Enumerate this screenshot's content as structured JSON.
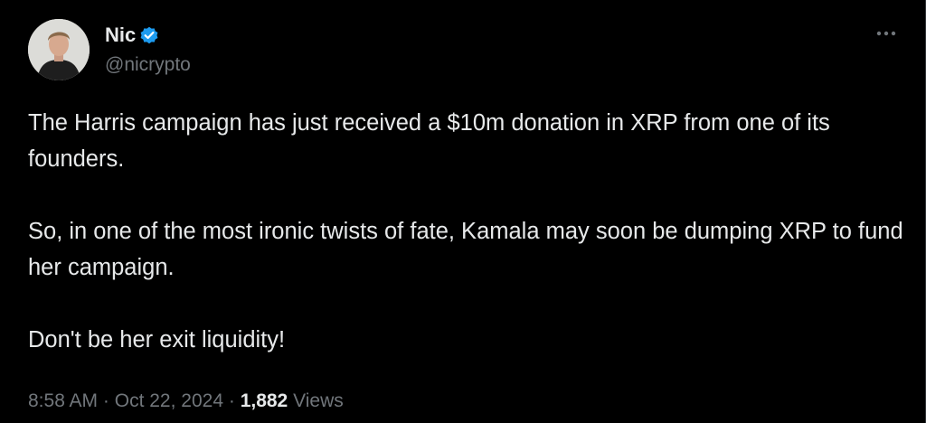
{
  "author": {
    "display_name": "Nic",
    "handle": "@nicrypto",
    "verified": true,
    "avatar_icon": "profile-photo"
  },
  "tweet": {
    "paragraphs": [
      "The Harris campaign has just received a $10m donation in XRP from one of its founders.",
      "So, in one of the most ironic twists of fate, Kamala may soon be dumping XRP to fund her campaign.",
      "Don't be her exit liquidity!"
    ]
  },
  "meta": {
    "time": "8:58 AM",
    "separator": "·",
    "date": "Oct 22, 2024",
    "views_count": "1,882",
    "views_label": "Views"
  },
  "icons": {
    "more": "more-dots-icon",
    "verified": "verified-badge-icon"
  },
  "colors": {
    "background": "#000000",
    "text": "#e7e9ea",
    "secondary_text": "#71767b",
    "verified_blue": "#1d9bf0"
  }
}
